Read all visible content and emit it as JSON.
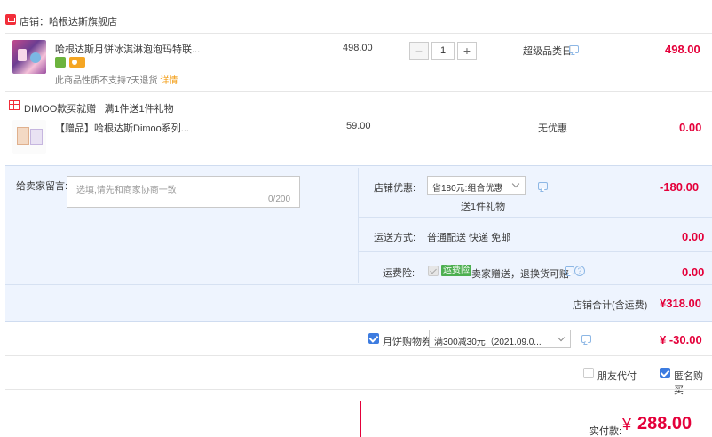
{
  "shop": {
    "label": "店铺：哈根达斯旗舰店",
    "icon": "shop-icon"
  },
  "items": [
    {
      "title": "哈根达斯月饼冰淇淋泡泡玛特联...",
      "return_note": "此商品性质不支持7天退货",
      "detail_link": "详情",
      "unit_price": "498.00",
      "quantity": "1",
      "promo": "超级品类日",
      "total": "498.00"
    }
  ],
  "gift_group": {
    "label": "DIMOO款买就赠",
    "rule": "满1件送1件礼物",
    "item": {
      "title": "【赠品】哈根达斯Dimoo系列...",
      "unit_price": "59.00",
      "promo": "无优惠",
      "total": "0.00"
    }
  },
  "memo": {
    "label": "给卖家留言:",
    "placeholder": "选填,请先和商家协商一致",
    "count": "0/200"
  },
  "shop_discount": {
    "label": "店铺优惠:",
    "selected": "省180元:组合优惠",
    "note": "送1件礼物",
    "amount": "-180.00"
  },
  "shipping": {
    "label": "运送方式:",
    "value": "普通配送 快递 免邮",
    "amount": "0.00"
  },
  "insurance": {
    "label": "运费险:",
    "tag": "运费险",
    "text": "卖家赠送，退换货可赔",
    "help": "?",
    "amount": "0.00"
  },
  "shop_total": {
    "label": "店铺合计(含运费)",
    "amount": "¥318.00"
  },
  "coupon": {
    "label": "月饼购物券",
    "selected": "满300减30元（2021.09.0...",
    "amount": "¥ -30.00"
  },
  "options": {
    "friend_pay": "朋友代付",
    "anonymous": "匿名购买"
  },
  "payment": {
    "label": "实付款:",
    "yen": "¥",
    "amount": "288.00"
  },
  "colors": {
    "accent_red": "#e4003a",
    "panel_bg": "#eef4fe",
    "checkbox_blue": "#3d7ce0"
  }
}
